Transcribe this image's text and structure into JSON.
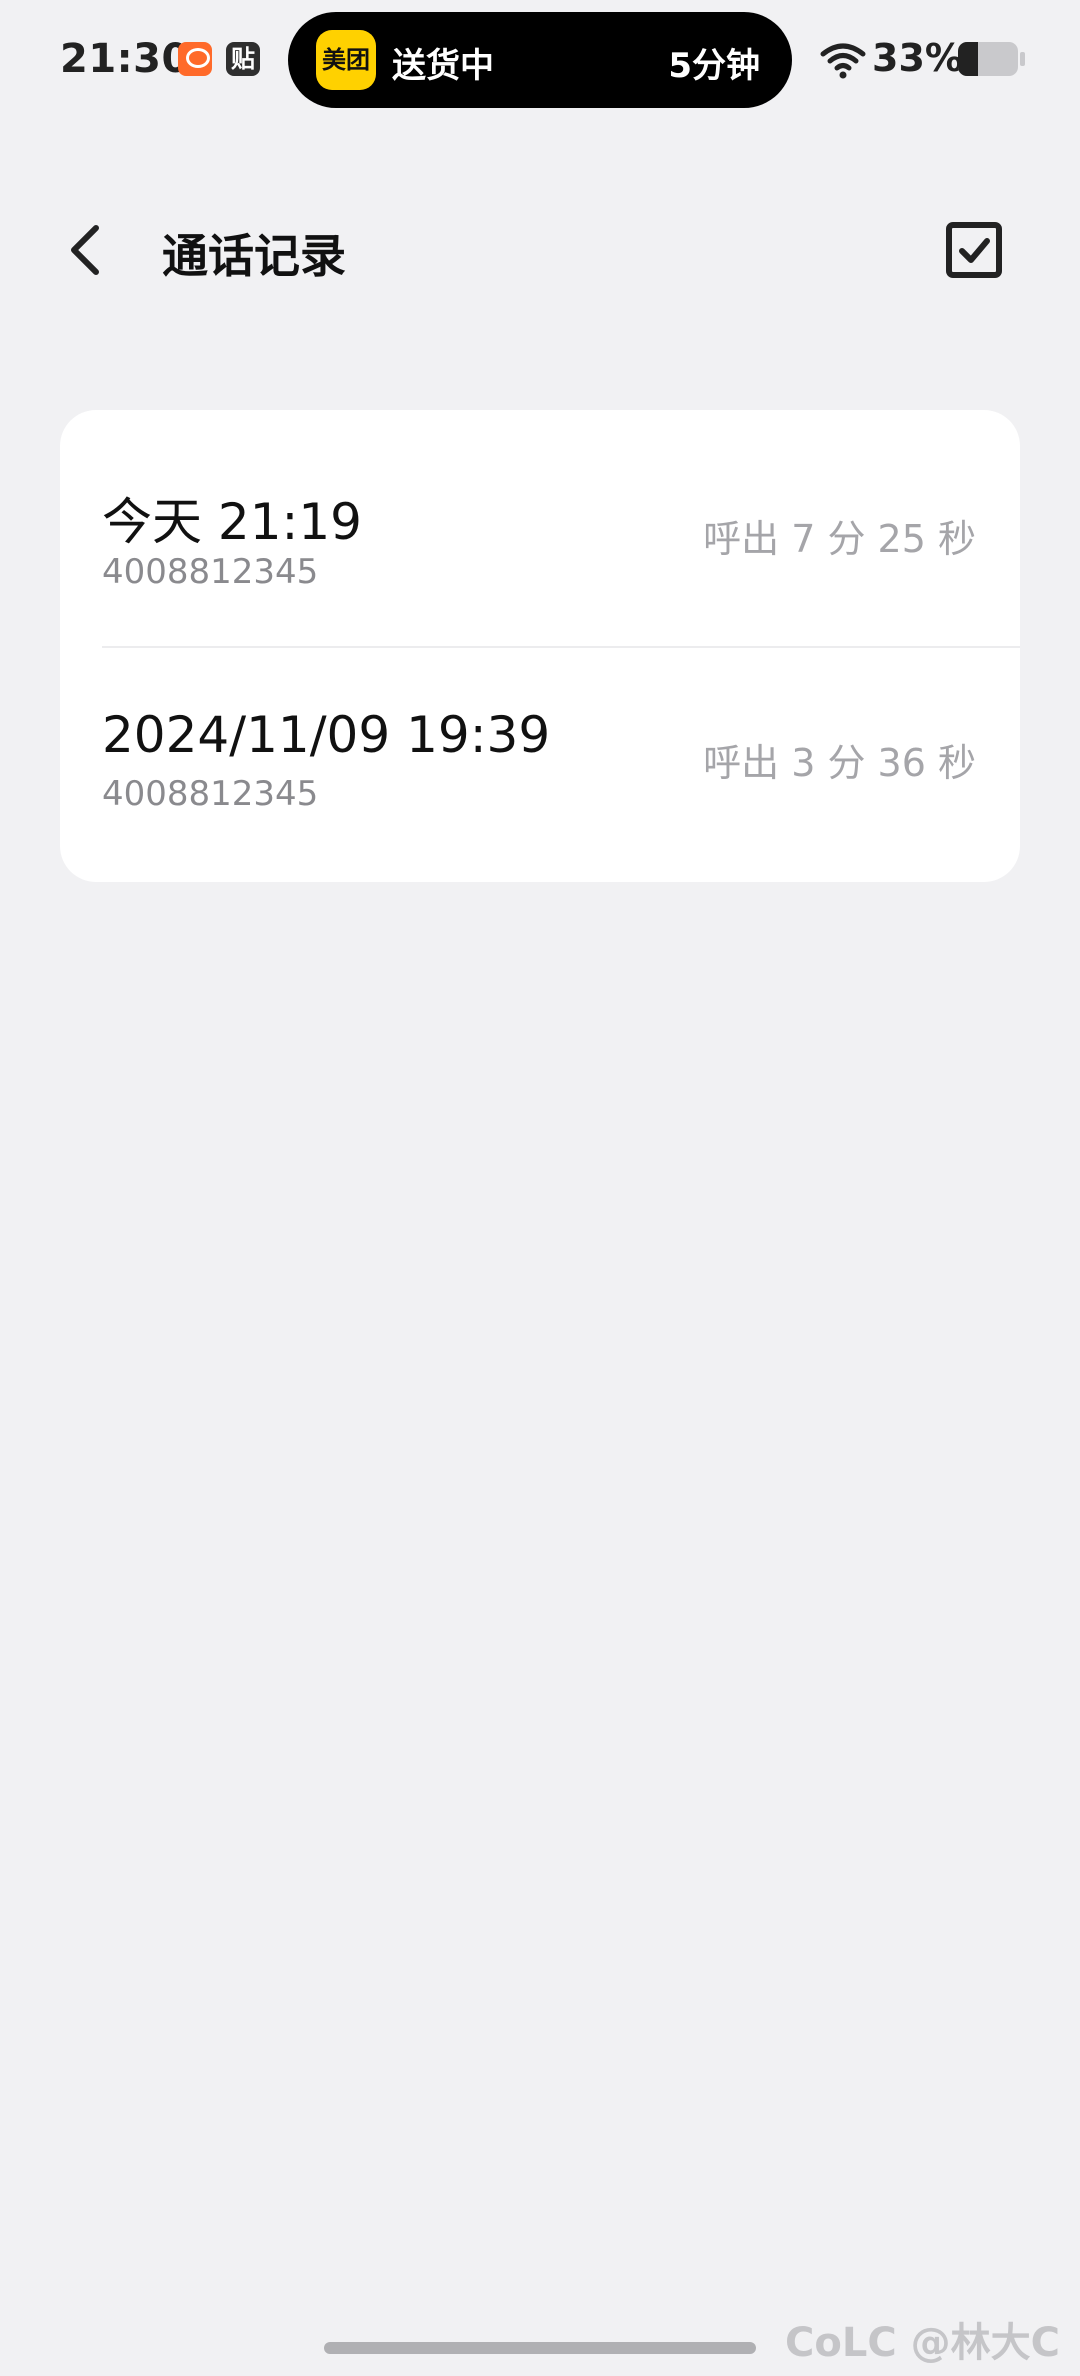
{
  "status_bar": {
    "time": "21:30",
    "app_icon_2_label": "贴",
    "battery_percent_text": "33%",
    "battery_level": 0.33
  },
  "live_activity": {
    "brand": "美团",
    "status": "送货中",
    "eta": "5分钟",
    "brand_color": "#ffd100"
  },
  "header": {
    "title": "通话记录"
  },
  "calls": [
    {
      "time": "今天 21:19",
      "number": "4008812345",
      "description": "呼出 7 分 25 秒"
    },
    {
      "time": "2024/11/09 19:39",
      "number": "4008812345",
      "description": "呼出 3 分 36 秒"
    }
  ],
  "watermark": "CoLC @林大C"
}
